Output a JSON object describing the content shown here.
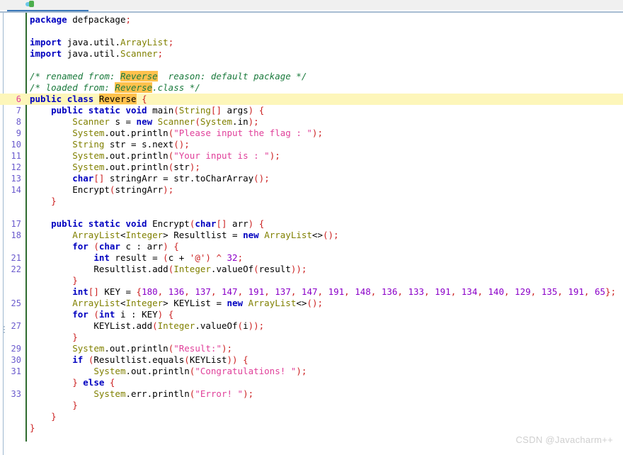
{
  "window": {
    "tab_icon": "java-class-icon",
    "accent_color": "#3a77b8",
    "watermark": "CSDN @Javacharm++"
  },
  "editor": {
    "language": "java",
    "current_line": 6,
    "highlighted_token": "Reverse",
    "highlight_color": "#ffc14d",
    "current_line_color": "#fdf6ba",
    "lines": [
      {
        "n": "",
        "text": "package defpackage;"
      },
      {
        "n": "",
        "text": ""
      },
      {
        "n": "",
        "text": "import java.util.ArrayList;"
      },
      {
        "n": "",
        "text": "import java.util.Scanner;"
      },
      {
        "n": "",
        "text": ""
      },
      {
        "n": "",
        "text": "/* renamed from: Reverse  reason: default package */"
      },
      {
        "n": "",
        "text": "/* loaded from: Reverse.class */"
      },
      {
        "n": "6",
        "text": "public class Reverse {"
      },
      {
        "n": "7",
        "text": "    public static void main(String[] args) {"
      },
      {
        "n": "8",
        "text": "        Scanner s = new Scanner(System.in);"
      },
      {
        "n": "9",
        "text": "        System.out.println(\"Please input the flag : \");"
      },
      {
        "n": "10",
        "text": "        String str = s.next();"
      },
      {
        "n": "11",
        "text": "        System.out.println(\"Your input is : \");"
      },
      {
        "n": "12",
        "text": "        System.out.println(str);"
      },
      {
        "n": "13",
        "text": "        char[] stringArr = str.toCharArray();"
      },
      {
        "n": "14",
        "text": "        Encrypt(stringArr);"
      },
      {
        "n": "",
        "text": "    }"
      },
      {
        "n": "",
        "text": ""
      },
      {
        "n": "17",
        "text": "    public static void Encrypt(char[] arr) {"
      },
      {
        "n": "18",
        "text": "        ArrayList<Integer> Resultlist = new ArrayList<>();"
      },
      {
        "n": "",
        "text": "        for (char c : arr) {"
      },
      {
        "n": "21",
        "text": "            int result = (c + '@') ^ 32;"
      },
      {
        "n": "22",
        "text": "            Resultlist.add(Integer.valueOf(result));"
      },
      {
        "n": "",
        "text": "        }"
      },
      {
        "n": "",
        "text": "        int[] KEY = {180, 136, 137, 147, 191, 137, 147, 191, 148, 136, 133, 191, 134, 140, 129, 135, 191, 65};"
      },
      {
        "n": "25",
        "text": "        ArrayList<Integer> KEYList = new ArrayList<>();"
      },
      {
        "n": "",
        "text": "        for (int i : KEY) {"
      },
      {
        "n": "27",
        "text": "            KEYList.add(Integer.valueOf(i));"
      },
      {
        "n": "",
        "text": "        }"
      },
      {
        "n": "29",
        "text": "        System.out.println(\"Result:\");"
      },
      {
        "n": "30",
        "text": "        if (Resultlist.equals(KEYList)) {"
      },
      {
        "n": "31",
        "text": "            System.out.println(\"Congratulations! \");"
      },
      {
        "n": "",
        "text": "        } else {"
      },
      {
        "n": "33",
        "text": "            System.err.println(\"Error! \");"
      },
      {
        "n": "",
        "text": "        }"
      },
      {
        "n": "",
        "text": "    }"
      },
      {
        "n": "",
        "text": "}"
      }
    ],
    "key_array": [
      180,
      136,
      137,
      147,
      191,
      137,
      147,
      191,
      148,
      136,
      133,
      191,
      134,
      140,
      129,
      135,
      191,
      65
    ]
  }
}
